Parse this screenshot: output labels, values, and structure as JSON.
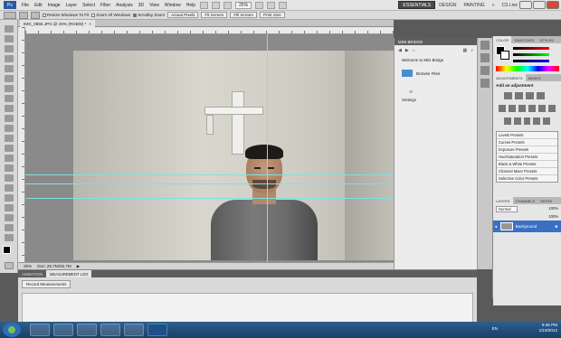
{
  "menubar": {
    "app_icon": "Ps",
    "items": [
      "File",
      "Edit",
      "Image",
      "Layer",
      "Select",
      "Filter",
      "Analysis",
      "3D",
      "View",
      "Window",
      "Help"
    ],
    "zoom": "25%",
    "workspaces": [
      "ESSENTIALS",
      "DESIGN",
      "PAINTING"
    ],
    "more": "»",
    "cs_live": "CS Live"
  },
  "options": {
    "resize_windows": "Resize Windows To Fit",
    "zoom_all": "Zoom All Windows",
    "scrubby_zoom": "Scrubby Zoom",
    "actual_pixels": "Actual Pixels",
    "fit_screen": "Fit Screen",
    "fill_screen": "Fill Screen",
    "print_size": "Print Size"
  },
  "document": {
    "tab_title": "IMG_0855.JPG @ 25% (RGB/8) *",
    "status_zoom": "25%",
    "status_doc": "Doc: 25.7M/25.7M"
  },
  "bridge": {
    "title": "MINI BRIDGE",
    "welcome": "Welcome to Mini Bridge",
    "browse": "Browse Files",
    "settings": "Settings"
  },
  "panels": {
    "color_tabs": [
      "COLOR",
      "SWATCHES",
      "STYLES"
    ],
    "adjust_tabs": [
      "ADJUSTMENTS",
      "MASKS"
    ],
    "add_adjustment": "Add an adjustment",
    "presets": [
      "Levels Presets",
      "Curves Presets",
      "Exposure Presets",
      "Hue/Saturation Presets",
      "Black & White Presets",
      "Channel Mixer Presets",
      "Selective Color Presets"
    ],
    "layers_tabs": [
      "LAYERS",
      "CHANNELS",
      "PATHS"
    ],
    "blend_mode": "Normal",
    "opacity": "100%",
    "fill": "100%",
    "background_layer": "Background"
  },
  "mlog": {
    "tabs": [
      "ANIMATION",
      "MEASUREMENT LOG"
    ],
    "record": "Record Measurements"
  },
  "taskbar": {
    "lang": "EN",
    "time": "9:46 PM",
    "date": "1/19/2012"
  },
  "colors": {
    "ui_bg": "#5a5a5a",
    "guide": "#7ee0e6",
    "taskbar": "#2d5f8e"
  }
}
